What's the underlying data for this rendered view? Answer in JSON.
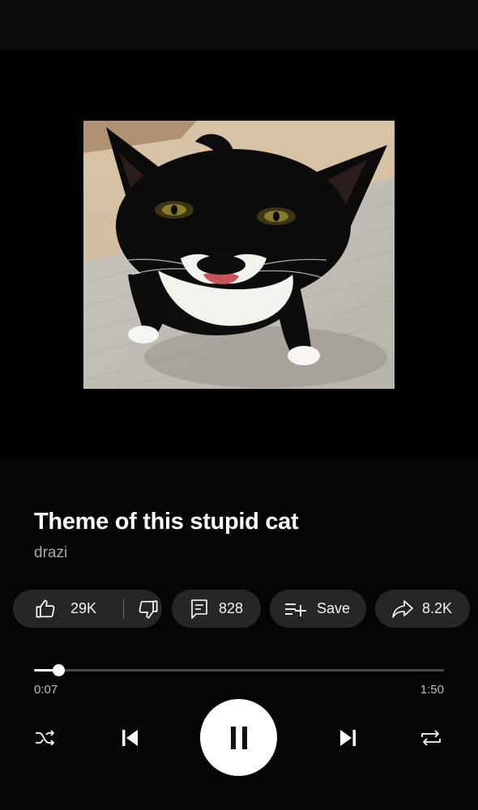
{
  "track": {
    "title": "Theme of this stupid cat",
    "artist": "drazi",
    "artwork_icon": "cat-album-art"
  },
  "actions": {
    "likes": "29K",
    "comments": "828",
    "save_label": "Save",
    "shares": "8.2K"
  },
  "playback": {
    "current_time": "0:07",
    "duration": "1:50",
    "progress": 0.06,
    "state": "playing"
  },
  "controls": {
    "shuffle": "shuffle-icon",
    "previous": "skip-previous-icon",
    "play_pause": "pause-icon",
    "next": "skip-next-icon",
    "repeat": "repeat-icon"
  },
  "colors": {
    "background": "#050505",
    "pill": "#262626",
    "artist_text": "#a9a9a9",
    "track_inactive": "#4a4a4a"
  }
}
